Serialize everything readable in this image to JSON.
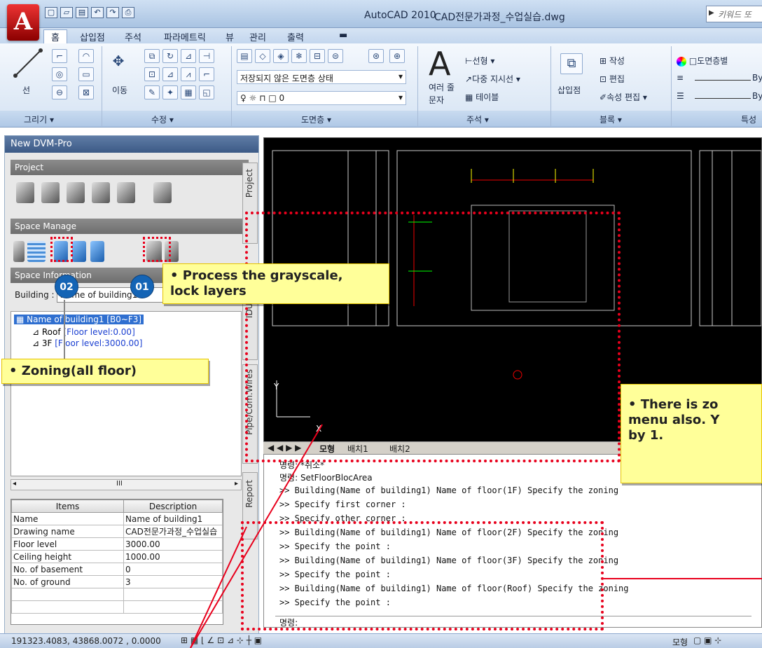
{
  "app": {
    "logo_letter": "A",
    "title": "AutoCAD 2010",
    "file": "CAD전문가과정_수업실습.dwg",
    "keyword_placeholder": "키워드 또"
  },
  "ribbon_tabs": [
    "홈",
    "삽입점",
    "주석",
    "파라메트릭",
    "뷰",
    "관리",
    "출력"
  ],
  "ribbon": {
    "draw_label": "선",
    "move_label": "이동",
    "layer_state": "저장되지 않은 도면층 상태",
    "layer_current": "0",
    "multiline_text_1": "여러 줄",
    "multiline_text_2": "문자",
    "linear": "선형",
    "multileader": "다중 지시선",
    "table": "테이블",
    "insert": "삽입점",
    "create": "작성",
    "edit": "편집",
    "attr_edit": "속성 편집",
    "bylayer_color": "도면층별",
    "bylayer_1": "By",
    "bylayer_2": "By",
    "groups": [
      "그리기",
      "수정",
      "도면층",
      "주석",
      "블록",
      "특성"
    ]
  },
  "palette": {
    "title": "New DVM-Pro",
    "sections": [
      "Project",
      "Space Manage",
      "Space Information"
    ],
    "building_label": "Building :",
    "building_value": "Name of building1",
    "tree": {
      "root": "Name of building1 [B0~F3]",
      "items": [
        {
          "name": "Roof",
          "level": "[Floor level:0.00]"
        },
        {
          "name": "3F",
          "level": "[Floor level:3000.00]"
        }
      ]
    },
    "props_headers": [
      "Items",
      "Description"
    ],
    "props_rows": [
      [
        "Name",
        "Name of building1"
      ],
      [
        "Drawing name",
        "CAD전문가과정_수업실습"
      ],
      [
        "Floor level",
        "3000.00"
      ],
      [
        "Ceiling height",
        "1000.00"
      ],
      [
        "No. of basement",
        "0"
      ],
      [
        "No. of ground",
        "3"
      ]
    ],
    "side_tabs": [
      "Project",
      "IDU/ODU",
      "Pipe/Com.Wires",
      "Report"
    ]
  },
  "layout_tabs": [
    "모형",
    "배치1",
    "배치2"
  ],
  "axis": {
    "x": "X",
    "y": "Y"
  },
  "command_lines": [
    "명령: *취소*",
    "명령: SetFloorBlocArea",
    ">> Building(Name of building1) Name of floor(1F) Specify the zoning",
    ">> Specify first corner :",
    ">> Specify other corner :",
    ">> Building(Name of building1) Name of floor(2F) Specify the zoning",
    ">> Specify the point :",
    ">> Building(Name of building1) Name of floor(3F) Specify the zoning",
    ">> Specify the point :",
    ">> Building(Name of building1) Name of floor(Roof) Specify the zoning",
    ">> Specify the point :"
  ],
  "command_prompt": "명령:",
  "status": {
    "coords": "191323.4083, 43868.0072 , 0.0000",
    "model": "모형"
  },
  "callouts": {
    "grayscale": "• Process the grayscale,\nlock layers",
    "zoning": "• Zoning(all floor)",
    "zoning_menu": "• There is zo\nmenu also. Y\nby 1.",
    "badge_01": "01",
    "badge_02": "02"
  },
  "colors": {
    "callout_bg": "#ffff99",
    "dash_red": "#e8001c",
    "badge_blue": "#1464b5",
    "canvas_bg": "#000000"
  }
}
